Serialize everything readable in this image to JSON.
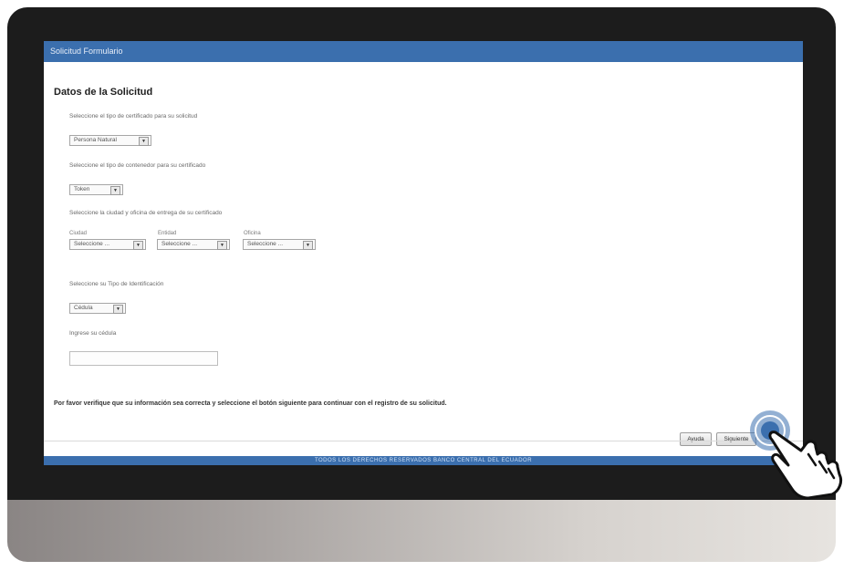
{
  "window": {
    "title": "Solicitud Formulario"
  },
  "form": {
    "section_title": "Datos de la Solicitud",
    "q_cert_type": "Seleccione el tipo de certificado para su solicitud",
    "cert_type_value": "Persona Natural",
    "q_container_type": "Seleccione el tipo de contenedor para su certificado",
    "container_type_value": "Token",
    "q_city_office": "Seleccione la ciudad y oficina de entrega de su certificado",
    "city_label": "Ciudad",
    "city_value": "Seleccione ...",
    "entity_label": "Entidad",
    "entity_value": "Seleccione ...",
    "office_label": "Oficina",
    "office_value": "Seleccione ...",
    "q_id_type": "Seleccione su Tipo de Identificación",
    "id_type_value": "Cédula",
    "cedula_label": "Ingrese su cédula",
    "cedula_value": ""
  },
  "notice": "Por favor verifique que su información sea correcta y seleccione el botón siguiente para continuar con el registro de su solicitud.",
  "buttons": {
    "help": "Ayuda",
    "next": "Siguiente"
  },
  "footer": "TODOS LOS DERECHOS RESERVADOS BANCO CENTRAL DEL ECUADOR",
  "icons": {
    "pointer": "hand-pointer-icon",
    "dropdown": "chevron-down-icon"
  },
  "colors": {
    "header": "#3b6fae",
    "bezel": "#1c1c1c",
    "tap_ring": "#3b6fae"
  }
}
